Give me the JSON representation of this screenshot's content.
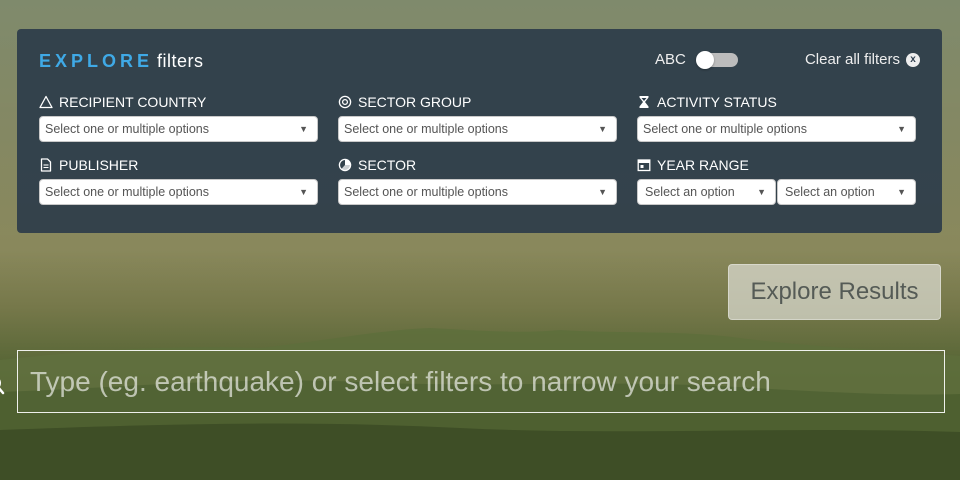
{
  "panel": {
    "title_explore": "EXPLORE",
    "title_filters": "filters",
    "abc_label": "ABC",
    "clear_label": "Clear all filters",
    "clear_icon": "x"
  },
  "filters": {
    "recipient_country": {
      "label": "RECIPIENT COUNTRY",
      "icon": "triangle-icon",
      "placeholder": "Select one or multiple options"
    },
    "sector_group": {
      "label": "SECTOR GROUP",
      "icon": "target-icon",
      "placeholder": "Select one or multiple options"
    },
    "activity_status": {
      "label": "ACTIVITY STATUS",
      "icon": "hourglass-icon",
      "placeholder": "Select one or multiple options"
    },
    "publisher": {
      "label": "PUBLISHER",
      "icon": "document-icon",
      "placeholder": "Select one or multiple options"
    },
    "sector": {
      "label": "SECTOR",
      "icon": "pie-chart-icon",
      "placeholder": "Select one or multiple options"
    },
    "year_range": {
      "label": "YEAR RANGE",
      "icon": "calendar-icon",
      "start_placeholder": "Select an option",
      "end_placeholder": "Select an option"
    }
  },
  "caret": "▼",
  "explore_button": "Explore Results",
  "search": {
    "placeholder": "Type (eg. earthquake) or select filters to narrow your search"
  },
  "colors": {
    "panel_bg": "#2d3c4a",
    "explore_accent": "#3fa9e6"
  }
}
